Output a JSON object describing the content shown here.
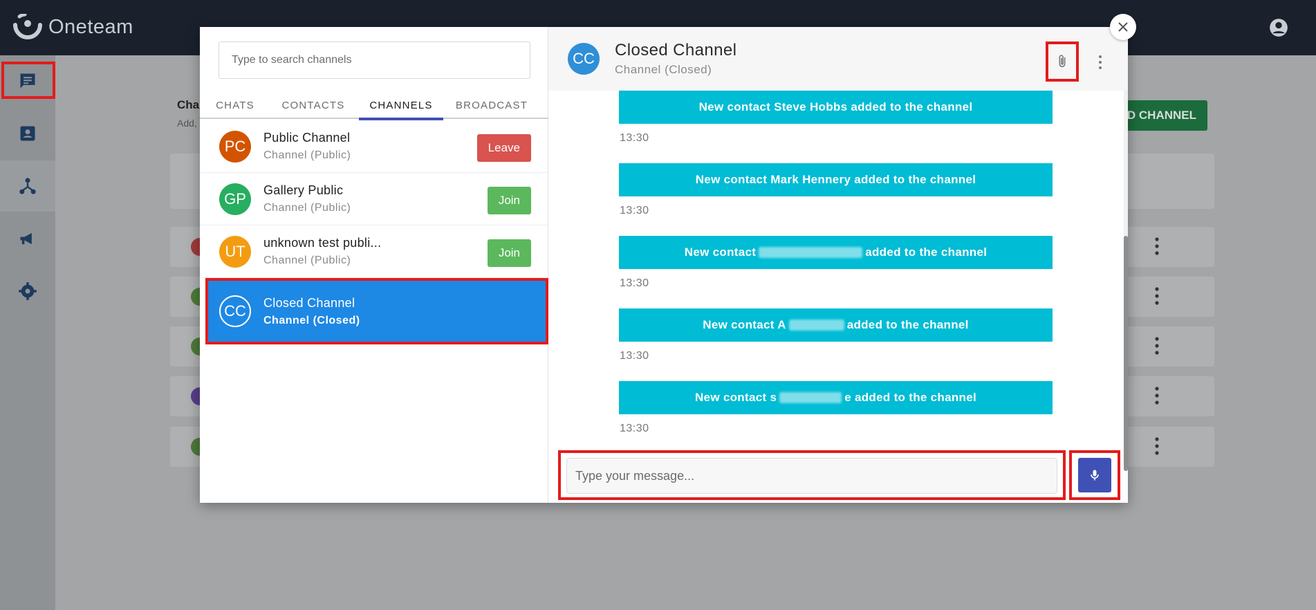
{
  "app": {
    "name": "Oneteam"
  },
  "background": {
    "title": "Cha",
    "subtitle": "Add,",
    "add_button_label": "D CHANNEL",
    "card_colors": [
      "#a03a3a",
      "#4e7a3a",
      "#4e7a3a",
      "#5a3e8a",
      "#4e7a3a"
    ]
  },
  "sidebar": {
    "items": [
      {
        "icon": "chat-icon"
      },
      {
        "icon": "contacts-icon"
      },
      {
        "icon": "channels-icon"
      },
      {
        "icon": "broadcast-icon"
      },
      {
        "icon": "settings-icon"
      }
    ]
  },
  "dialog": {
    "search": {
      "placeholder": "Type to search channels",
      "value": ""
    },
    "tabs": [
      {
        "label": "CHATS",
        "active": false
      },
      {
        "label": "CONTACTS",
        "active": false
      },
      {
        "label": "CHANNELS",
        "active": true
      },
      {
        "label": "BROADCAST",
        "active": false
      }
    ],
    "channels": [
      {
        "initials": "PC",
        "name": "Public Channel",
        "type": "Channel (Public)",
        "action": "Leave",
        "color": "#d35400"
      },
      {
        "initials": "GP",
        "name": "Gallery Public",
        "type": "Channel (Public)",
        "action": "Join",
        "color": "#27ae60"
      },
      {
        "initials": "UT",
        "name": "unknown test publi...",
        "type": "Channel (Public)",
        "action": "Join",
        "color": "#f39c12"
      },
      {
        "initials": "CC",
        "name": "Closed Channel",
        "type": "Channel (Closed)",
        "action": "",
        "color": "#1e88e5"
      }
    ],
    "chat": {
      "initials": "CC",
      "name": "Closed Channel",
      "type": "Channel (Closed)",
      "messages": [
        {
          "prefix": "New contact Steve Hobbs added to the channel",
          "suffix": "",
          "time": "13:30"
        },
        {
          "prefix": "New contact Mark Hennery added to the channel",
          "suffix": "",
          "time": "13:30"
        },
        {
          "prefix": "New contact",
          "suffix": "added to the channel",
          "time": "13:30"
        },
        {
          "prefix": "New contact A",
          "suffix": "added to the channel",
          "time": "13:30"
        },
        {
          "prefix": "New contact s",
          "suffix": "e added to the channel",
          "time": "13:30"
        }
      ],
      "composer_placeholder": "Type your message..."
    }
  },
  "colors": {
    "accent": "#3f51b5",
    "selected": "#1e88e5",
    "system_message": "#00bcd4",
    "highlight": "#e31b1b"
  }
}
